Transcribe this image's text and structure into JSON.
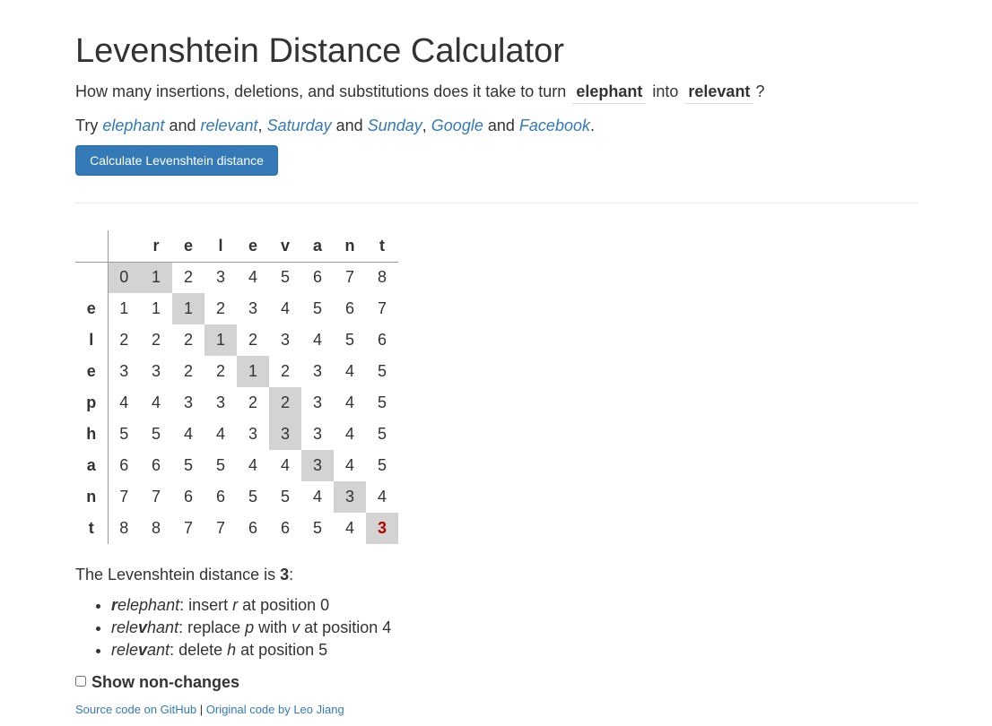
{
  "title": "Levenshtein Distance Calculator",
  "intro": {
    "prefix": "How many insertions, deletions, and substitutions does it take to turn",
    "word1": "elephant",
    "middle": "into",
    "word2": "relevant",
    "suffix": "?"
  },
  "try": {
    "prefix": "Try",
    "pairs": [
      {
        "a": "elephant",
        "and": "and",
        "b": "relevant",
        "sep": ","
      },
      {
        "a": "Saturday",
        "and": "and",
        "b": "Sunday",
        "sep": ","
      },
      {
        "a": "Google",
        "and": "and",
        "b": "Facebook",
        "sep": "."
      }
    ]
  },
  "button_label": "Calculate Levenshtein distance",
  "matrix": {
    "columns": [
      "r",
      "e",
      "l",
      "e",
      "v",
      "a",
      "n",
      "t"
    ],
    "rows": [
      "",
      "e",
      "l",
      "e",
      "p",
      "h",
      "a",
      "n",
      "t"
    ],
    "values": [
      [
        0,
        1,
        2,
        3,
        4,
        5,
        6,
        7,
        8
      ],
      [
        1,
        1,
        1,
        2,
        3,
        4,
        5,
        6,
        7
      ],
      [
        2,
        2,
        2,
        1,
        2,
        3,
        4,
        5,
        6
      ],
      [
        3,
        3,
        2,
        2,
        1,
        2,
        3,
        4,
        5
      ],
      [
        4,
        4,
        3,
        3,
        2,
        2,
        3,
        4,
        5
      ],
      [
        5,
        5,
        4,
        4,
        3,
        3,
        3,
        4,
        5
      ],
      [
        6,
        6,
        5,
        5,
        4,
        4,
        3,
        4,
        5
      ],
      [
        7,
        7,
        6,
        6,
        5,
        5,
        4,
        3,
        4
      ],
      [
        8,
        8,
        7,
        7,
        6,
        6,
        5,
        4,
        3
      ]
    ],
    "path": [
      [
        0,
        0
      ],
      [
        0,
        1
      ],
      [
        1,
        2
      ],
      [
        2,
        3
      ],
      [
        3,
        4
      ],
      [
        4,
        5
      ],
      [
        5,
        5
      ],
      [
        6,
        6
      ],
      [
        7,
        7
      ],
      [
        8,
        8
      ]
    ],
    "path_color": "#d3d3d3",
    "final_color": "#b00000"
  },
  "result": {
    "prefix": "The Levenshtein distance is",
    "distance": "3",
    "suffix": ":"
  },
  "operations": [
    {
      "word": [
        {
          "t": "r",
          "b": true
        },
        {
          "t": "elephant",
          "b": false
        }
      ],
      "desc": [
        {
          "t": ": insert ",
          "i": false
        },
        {
          "t": "r",
          "i": true
        },
        {
          "t": " at position 0",
          "i": false
        }
      ]
    },
    {
      "word": [
        {
          "t": "rele",
          "b": false
        },
        {
          "t": "v",
          "b": true
        },
        {
          "t": "hant",
          "b": false
        }
      ],
      "desc": [
        {
          "t": ": replace ",
          "i": false
        },
        {
          "t": "p",
          "i": true
        },
        {
          "t": " with ",
          "i": false
        },
        {
          "t": "v",
          "i": true
        },
        {
          "t": " at position 4",
          "i": false
        }
      ]
    },
    {
      "word": [
        {
          "t": "rele",
          "b": false
        },
        {
          "t": "v",
          "b": true
        },
        {
          "t": "ant",
          "b": false
        }
      ],
      "desc": [
        {
          "t": ": delete ",
          "i": false
        },
        {
          "t": "h",
          "i": true
        },
        {
          "t": " at position 5",
          "i": false
        }
      ]
    }
  ],
  "show_nonchanges_label": "Show non-changes",
  "footer": {
    "link1": "Source code on GitHub",
    "sep": "|",
    "link2": "Original code by Leo Jiang"
  },
  "colors": {
    "link": "#337ab7",
    "button_bg": "#337ab7",
    "text": "#333333"
  }
}
